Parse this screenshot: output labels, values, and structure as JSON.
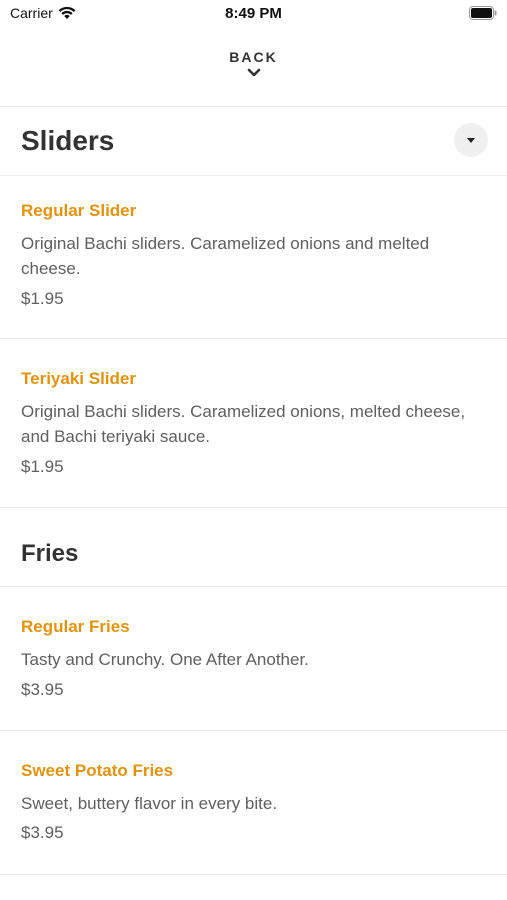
{
  "status_bar": {
    "carrier": "Carrier",
    "time": "8:49 PM"
  },
  "nav": {
    "back_label": "BACK"
  },
  "sections": [
    {
      "title": "Sliders",
      "items": [
        {
          "name": "Regular Slider",
          "description": "Original Bachi sliders. Caramelized onions and melted cheese.",
          "price": "$1.95"
        },
        {
          "name": "Teriyaki Slider",
          "description": "Original Bachi sliders. Caramelized onions, melted cheese, and Bachi teriyaki sauce.",
          "price": "$1.95"
        }
      ]
    },
    {
      "title": "Fries",
      "items": [
        {
          "name": "Regular Fries",
          "description": "Tasty and Crunchy. One After Another.",
          "price": "$3.95"
        },
        {
          "name": "Sweet Potato Fries",
          "description": "Sweet, buttery flavor in every bite.",
          "price": "$3.95"
        }
      ]
    }
  ],
  "colors": {
    "item_name": "#e0930f",
    "text_secondary": "#5f5f5f",
    "title": "#333333",
    "divider": "#ececec"
  },
  "icons": {
    "wifi": "wifi-icon",
    "battery": "battery-icon",
    "back": "chevron-down-icon",
    "collapse": "caret-down-icon"
  }
}
